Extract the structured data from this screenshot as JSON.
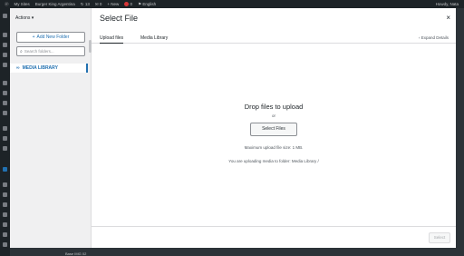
{
  "adminbar": {
    "site": "My Sites",
    "site_name": "Burger King Argentina",
    "updates": "13",
    "comments": "0",
    "new": "+ New",
    "notif": "0",
    "lang": "English",
    "howdy": "Howdy, Nata"
  },
  "sidebar": {
    "actions": "Actions",
    "add_folder": "Add New Folder",
    "search_placeholder": "Search folders...",
    "media_library": "MEDIA LIBRARY"
  },
  "modal": {
    "title": "Select File",
    "close": "×",
    "tabs": [
      "Upload files",
      "Media Library"
    ],
    "expand": "Expand Details",
    "drop": "Drop files to upload",
    "or": "or",
    "select_files": "Select Files",
    "max_size": "Maximum upload file size: 1 MB.",
    "uploading": "You are uploading media to folder: Media Library /",
    "select_button": "Select"
  },
  "background": {
    "under_text": "Base IMG 02"
  }
}
